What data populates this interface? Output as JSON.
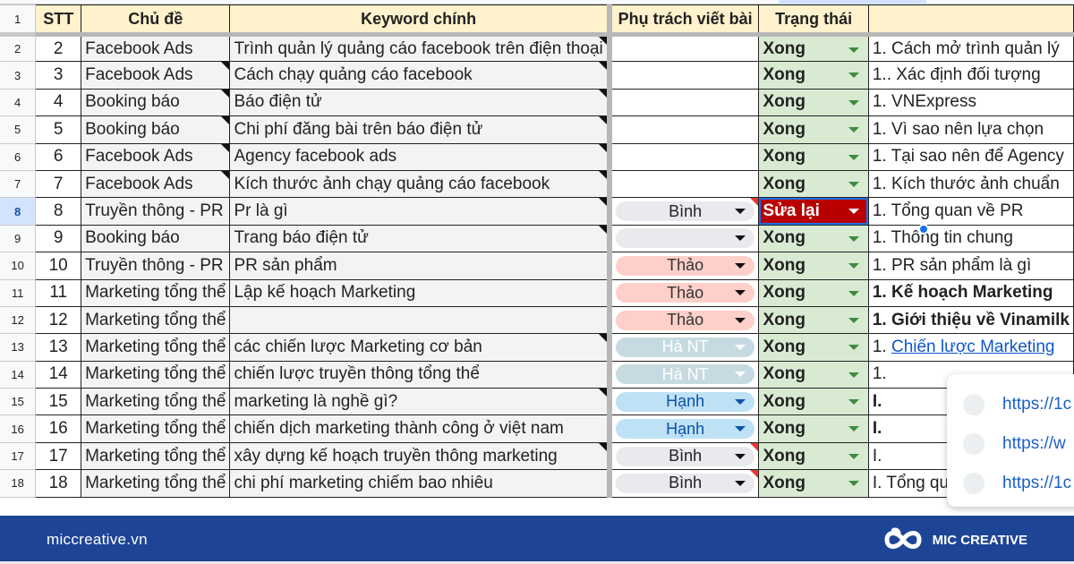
{
  "columns": {
    "stt": "STT",
    "topic": "Chủ đề",
    "keyword": "Keyword chính",
    "owner": "Phụ trách viết bài",
    "status": "Trạng thái",
    "outline": ""
  },
  "header_row_number": "1",
  "rows": [
    {
      "row": "2",
      "stt": "2",
      "topic": "Facebook Ads",
      "keyword": "Trình quản lý quảng cáo facebook trên điện thoại",
      "owner": "",
      "status": "Xong",
      "outline": "1. Cách mở trình quản lý"
    },
    {
      "row": "3",
      "stt": "3",
      "topic": "Facebook Ads",
      "keyword": "Cách chạy quảng cáo facebook",
      "owner": "",
      "status": "Xong",
      "outline": "1.. Xác định đối tượng"
    },
    {
      "row": "4",
      "stt": "4",
      "topic": "Booking báo",
      "keyword": "Báo điện tử",
      "owner": "",
      "status": "Xong",
      "outline": "1. VNExpress"
    },
    {
      "row": "5",
      "stt": "5",
      "topic": "Booking báo",
      "keyword": "Chi phí đăng bài trên báo điện tử",
      "owner": "",
      "status": "Xong",
      "outline": "1. Vì sao nên lựa chọn"
    },
    {
      "row": "6",
      "stt": "6",
      "topic": "Facebook Ads",
      "keyword": "Agency facebook ads",
      "owner": "",
      "status": "Xong",
      "outline": "1. Tại sao nên để Agency"
    },
    {
      "row": "7",
      "stt": "7",
      "topic": "Facebook Ads",
      "keyword": "Kích thước ảnh chạy quảng cáo facebook",
      "owner": "",
      "status": "Xong",
      "outline": "1. Kích thước ảnh chuẩn"
    },
    {
      "row": "8",
      "stt": "8",
      "topic": "Truyền thông - PR",
      "keyword": "Pr là gì",
      "owner": "Bình",
      "status": "Sửa lại",
      "outline": "1. Tổng quan về PR"
    },
    {
      "row": "9",
      "stt": "9",
      "topic": "Booking báo",
      "keyword": "Trang báo điện tử",
      "owner": "",
      "status": "Xong",
      "outline": "1. Thông tin chung"
    },
    {
      "row": "10",
      "stt": "10",
      "topic": "Truyền thông - PR",
      "keyword": "PR sản phẩm",
      "owner": "Thảo",
      "status": "Xong",
      "outline": "1. PR sản phẩm là gì"
    },
    {
      "row": "11",
      "stt": "11",
      "topic": "Marketing tổng thể",
      "keyword": "Lập kế hoạch Marketing",
      "owner": "Thảo",
      "status": "Xong",
      "outline": "1. Kế hoạch Marketing"
    },
    {
      "row": "12",
      "stt": "12",
      "topic": "Marketing tổng thể",
      "keyword": "",
      "owner": "Thảo",
      "status": "Xong",
      "outline": "1. Giới thiệu về Vinamilk"
    },
    {
      "row": "13",
      "stt": "13",
      "topic": "Marketing tổng thể",
      "keyword": "các chiến lược Marketing cơ bản",
      "owner": "Hà NT",
      "status": "Xong",
      "outline": "1. Chiến lược Marketing"
    },
    {
      "row": "14",
      "stt": "14",
      "topic": "Marketing tổng thể",
      "keyword": "chiến lược truyền thông tổng thể",
      "owner": "Hà NT",
      "status": "Xong",
      "outline": "1."
    },
    {
      "row": "15",
      "stt": "15",
      "topic": "Marketing tổng thể",
      "keyword": "marketing là nghề gì?",
      "owner": "Hạnh",
      "status": "Xong",
      "outline": "I."
    },
    {
      "row": "16",
      "stt": "16",
      "topic": "Marketing tổng thể",
      "keyword": "chiến dịch marketing thành công ở việt nam",
      "owner": "Hạnh",
      "status": "Xong",
      "outline": "I."
    },
    {
      "row": "17",
      "stt": "17",
      "topic": "Marketing tổng thể",
      "keyword": "xây dựng kế hoạch truyền thông marketing",
      "owner": "Bình",
      "status": "Xong",
      "outline": "I."
    },
    {
      "row": "18",
      "stt": "18",
      "topic": "Marketing tổng thể",
      "keyword": "chi phí marketing chiếm bao nhiêu",
      "owner": "Bình",
      "status": "Xong",
      "outline": "I. Tổng quan về chi phí"
    }
  ],
  "link_popup": {
    "items": [
      "https://1c",
      "https://w",
      "https://1c"
    ]
  },
  "footer": {
    "site": "miccreative.vn",
    "brand": "MIC CREATIVE"
  },
  "colors": {
    "header_bg": "#fff2cc",
    "done_bg": "#d9ead3",
    "done_text": "#1e7e45",
    "redo_bg": "#b80000",
    "footer_bg": "#1e4595"
  }
}
